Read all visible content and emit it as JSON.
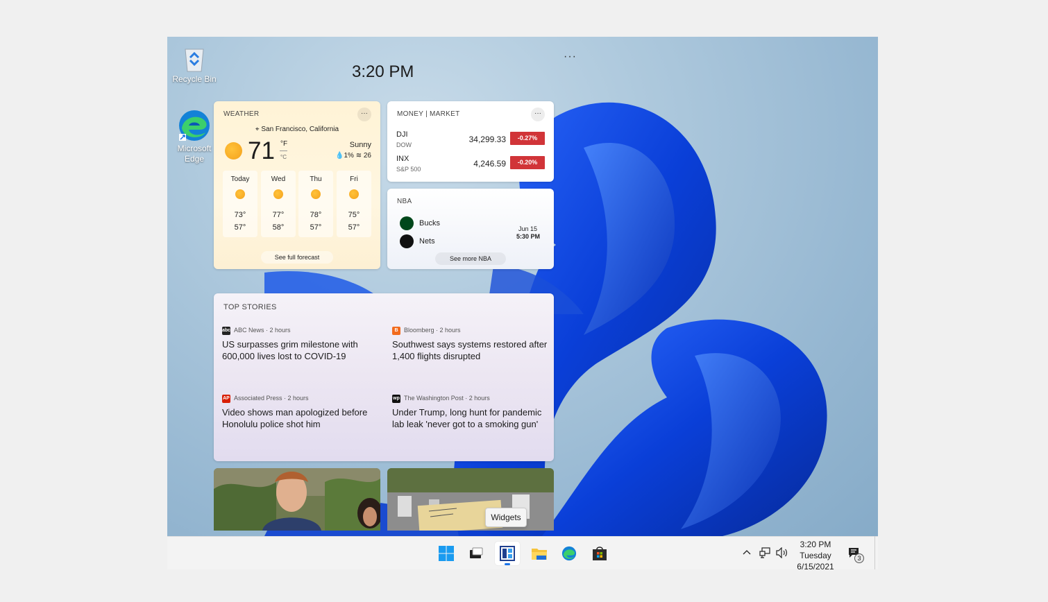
{
  "desktop": {
    "icons": [
      {
        "label": "Recycle Bin",
        "icon": "recycle-bin-icon"
      },
      {
        "label": "Microsoft Edge",
        "icon": "edge-icon"
      }
    ]
  },
  "widgets": {
    "time": "3:20 PM",
    "menu": "···",
    "weather": {
      "title": "WEATHER",
      "more": "···",
      "location": "San Francisco, California",
      "temperature": "71",
      "unit_f": "°F",
      "unit_c": "°C",
      "condition": "Sunny",
      "precip": "1%",
      "wind": "26",
      "days": [
        {
          "name": "Today",
          "hi": "73°",
          "lo": "57°"
        },
        {
          "name": "Wed",
          "hi": "77°",
          "lo": "58°"
        },
        {
          "name": "Thu",
          "hi": "78°",
          "lo": "57°"
        },
        {
          "name": "Fri",
          "hi": "75°",
          "lo": "57°"
        }
      ],
      "forecast_button": "See full forecast"
    },
    "money": {
      "title": "MONEY | MARKET",
      "more": "···",
      "stocks": [
        {
          "symbol": "DJI",
          "name": "DOW",
          "value": "34,299.33",
          "change": "-0.27%"
        },
        {
          "symbol": "INX",
          "name": "S&P 500",
          "value": "4,246.59",
          "change": "-0.20%"
        }
      ],
      "negative_color": "#d13438"
    },
    "nba": {
      "title": "NBA",
      "teams": [
        {
          "name": "Bucks",
          "color": "#00471b"
        },
        {
          "name": "Nets",
          "color": "#111111"
        }
      ],
      "date": "Jun 15",
      "time": "5:30 PM",
      "more_button": "See more NBA"
    },
    "stories": {
      "title": "TOP STORIES",
      "items": [
        {
          "source": "ABC News · 2 hours",
          "logo": "abc",
          "logo_color": "#222222",
          "headline": "US surpasses grim milestone with 600,000 lives lost to COVID-19"
        },
        {
          "source": "Bloomberg · 2 hours",
          "logo": "B",
          "logo_color": "#f26b1d",
          "headline": "Southwest says systems restored after 1,400 flights disrupted"
        },
        {
          "source": "Associated Press · 2 hours",
          "logo": "AP",
          "logo_color": "#d81e05",
          "headline": "Video shows man apologized before Honolulu police shot him"
        },
        {
          "source": "The Washington Post · 2 hours",
          "logo": "wp",
          "logo_color": "#111111",
          "headline": "Under Trump, long hunt for pandemic lab leak 'never got to a smoking gun'"
        }
      ]
    }
  },
  "tooltip": "Widgets",
  "taskbar": {
    "apps": [
      {
        "name": "start-button",
        "icon": "windows-logo-icon"
      },
      {
        "name": "task-view-button",
        "icon": "task-view-icon"
      },
      {
        "name": "widgets-button",
        "icon": "widgets-icon",
        "active": true
      },
      {
        "name": "file-explorer-button",
        "icon": "folder-icon"
      },
      {
        "name": "edge-button",
        "icon": "edge-icon"
      },
      {
        "name": "store-button",
        "icon": "store-icon"
      }
    ],
    "tray": {
      "chevron": "^",
      "time": "3:20 PM",
      "day": "Tuesday",
      "date": "6/15/2021",
      "notifications": "3"
    },
    "accent": "#1a73e8"
  }
}
